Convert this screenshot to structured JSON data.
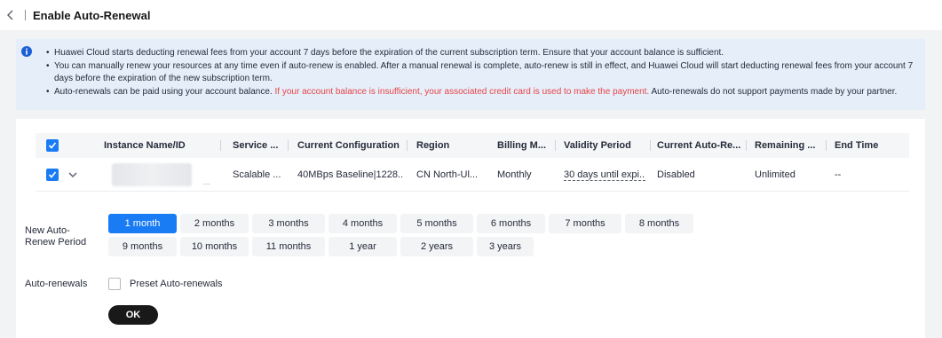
{
  "header": {
    "title": "Enable Auto-Renewal",
    "back_icon": "chevron-left-icon"
  },
  "notice": {
    "icon": "info-icon",
    "line1": "Huawei Cloud starts deducting renewal fees from your account 7 days before the expiration of the current subscription term. Ensure that your account balance is sufficient.",
    "line2a": "You can manually renew your resources at any time even if auto-renew is enabled. After a manual renewal is complete, auto-renew is still in effect, and Huawei Cloud will start deducting renewal fees from your account 7",
    "line2b": "days before the expiration of the new subscription term.",
    "line3_start": "Auto-renewals can be paid using your account balance.",
    "line3_warn": "If your account balance is insufficient, your associated credit card is used to make the payment.",
    "line3_end": "Auto-renewals do not support payments made by your partner.",
    "warn_color": "#e54545"
  },
  "table": {
    "columns": [
      "Instance Name/ID",
      "Service ...",
      "Current Configuration",
      "Region",
      "Billing M...",
      "Validity Period",
      "Current Auto-Re...",
      "Remaining ...",
      "End Time"
    ],
    "row": {
      "name_suffix": "...",
      "service": "Scalable ...",
      "configuration": "40MBps Baseline|1228...",
      "region": "CN North-Ul...",
      "billing": "Monthly",
      "validity": "30 days until expi...",
      "auto_renew": "Disabled",
      "remaining": "Unlimited",
      "end_time": "--"
    }
  },
  "period": {
    "label": "New Auto-Renew Period",
    "options_row1": [
      "1 month",
      "2 months",
      "3 months",
      "4 months",
      "5 months",
      "6 months",
      "7 months",
      "8 months"
    ],
    "options_row2": [
      "9 months",
      "10 months",
      "11 months",
      "1 year",
      "2 years",
      "3 years"
    ],
    "selected": "1 month"
  },
  "auto_renewals": {
    "label": "Auto-renewals",
    "checkbox_label": "Preset Auto-renewals"
  },
  "ok_label": "OK",
  "colors": {
    "accent": "#1a7cf5",
    "notice_bg": "#e6eefa",
    "button_dark": "#191919"
  }
}
